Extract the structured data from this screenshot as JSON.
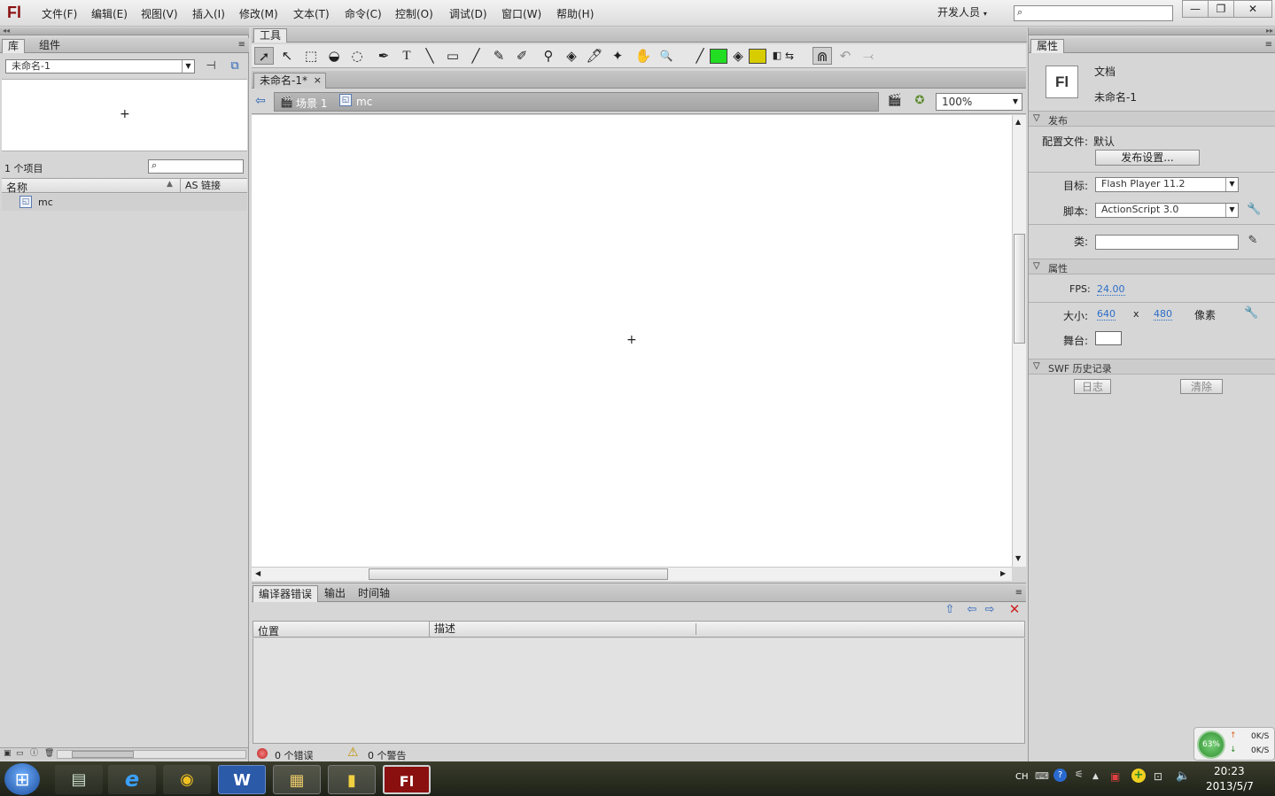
{
  "app": {
    "logo": "Fl"
  },
  "menu": [
    "文件(F)",
    "编辑(E)",
    "视图(V)",
    "插入(I)",
    "修改(M)",
    "文本(T)",
    "命令(C)",
    "控制(O)",
    "调试(D)",
    "窗口(W)",
    "帮助(H)"
  ],
  "workspace": "开发人员",
  "window_buttons": {
    "minimize": "—",
    "restore": "❐",
    "close": "✕"
  },
  "library": {
    "tabs": [
      "库",
      "组件"
    ],
    "document_select": "未命名-1",
    "item_count": "1 个项目",
    "col_name": "名称",
    "col_linkage": "AS 链接",
    "items": [
      "mc"
    ],
    "preview_cross": "+"
  },
  "tools": {
    "title": "工具",
    "icons": [
      "➚",
      "↖",
      "⬚",
      "◒",
      "◌",
      "✒",
      "T",
      "╲",
      "▭",
      "╱",
      "✎",
      "✐",
      "⚲",
      "◈",
      "🖊",
      "✦",
      "✋",
      "🔍",
      "╱",
      "",
      "◈",
      "",
      "◧",
      "⇆",
      "⋒",
      "↶",
      "⤙"
    ],
    "stroke_color": "#22dd22",
    "fill_color": "#d6cc00"
  },
  "document": {
    "tab_label": "未命名-1*",
    "tab_close": "×",
    "back_icon": "⇦",
    "breadcrumb": [
      "场景 1",
      "mc"
    ],
    "zoom": "100%",
    "stage_cross": "+"
  },
  "output_panel": {
    "tabs": [
      "编译器错误",
      "输出",
      "时间轴"
    ],
    "col_location": "位置",
    "col_description": "描述",
    "errors": "0 个错误",
    "warnings": "0 个警告"
  },
  "properties": {
    "tab": "属性",
    "doc_type": "文档",
    "doc_name": "未命名-1",
    "doc_icon": "Fl",
    "publish_section": "发布",
    "profile_label": "配置文件:",
    "profile_value": "默认",
    "publish_settings_btn": "发布设置...",
    "target_label": "目标:",
    "target_value": "Flash Player 11.2",
    "script_label": "脚本:",
    "script_value": "ActionScript 3.0",
    "class_label": "类:",
    "props_section": "属性",
    "fps_label": "FPS:",
    "fps_value": "24.00",
    "size_label": "大小:",
    "width": "640",
    "times": "x",
    "height": "480",
    "unit": "像素",
    "stage_label": "舞台:",
    "stage_color": "#ffffff",
    "swf_section": "SWF 历史记录",
    "log_btn": "日志",
    "clear_btn": "清除"
  },
  "net_widget": {
    "percent": "63%",
    "up": "0K/S",
    "down": "0K/S"
  },
  "taskbar": {
    "start": "⊞",
    "apps": [
      "▤",
      "e",
      "◉",
      "W",
      "▦",
      "▮",
      "Fl"
    ],
    "tray_lang": "CH",
    "time": "20:23",
    "date": "2013/5/7"
  }
}
